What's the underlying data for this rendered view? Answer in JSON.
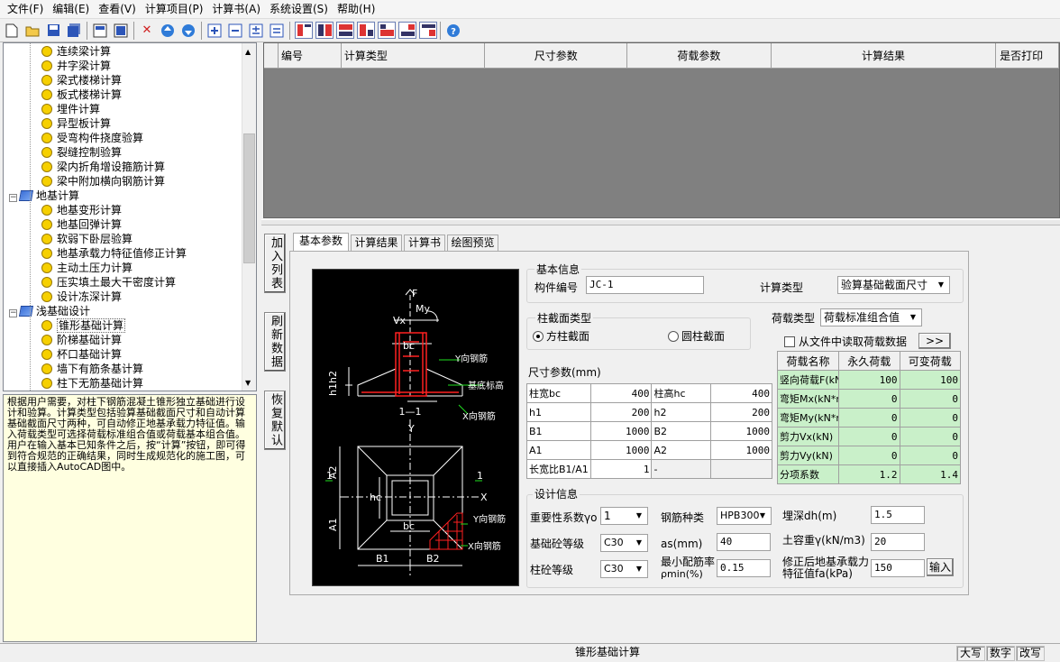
{
  "menu": [
    "文件(F)",
    "编辑(E)",
    "查看(V)",
    "计算项目(P)",
    "计算书(A)",
    "系统设置(S)",
    "帮助(H)"
  ],
  "tree": {
    "items": [
      {
        "label": "连续梁计算",
        "type": "leaf"
      },
      {
        "label": "井字梁计算",
        "type": "leaf"
      },
      {
        "label": "梁式楼梯计算",
        "type": "leaf"
      },
      {
        "label": "板式楼梯计算",
        "type": "leaf"
      },
      {
        "label": "埋件计算",
        "type": "leaf"
      },
      {
        "label": "异型板计算",
        "type": "leaf"
      },
      {
        "label": "受弯构件挠度验算",
        "type": "leaf"
      },
      {
        "label": "裂缝控制验算",
        "type": "leaf"
      },
      {
        "label": "梁内折角增设箍筋计算",
        "type": "leaf"
      },
      {
        "label": "梁中附加横向钢筋计算",
        "type": "leaf"
      },
      {
        "label": "地基计算",
        "type": "group"
      },
      {
        "label": "地基变形计算",
        "type": "leaf"
      },
      {
        "label": "地基回弹计算",
        "type": "leaf"
      },
      {
        "label": "软弱下卧层验算",
        "type": "leaf"
      },
      {
        "label": "地基承载力特征值修正计算",
        "type": "leaf"
      },
      {
        "label": "主动土压力计算",
        "type": "leaf"
      },
      {
        "label": "压实填土最大干密度计算",
        "type": "leaf"
      },
      {
        "label": "设计冻深计算",
        "type": "leaf"
      },
      {
        "label": "浅基础设计",
        "type": "group"
      },
      {
        "label": "锥形基础计算",
        "type": "leaf-selected"
      },
      {
        "label": "阶梯基础计算",
        "type": "leaf"
      },
      {
        "label": "杯口基础计算",
        "type": "leaf"
      },
      {
        "label": "墙下有筋条基计算",
        "type": "leaf"
      },
      {
        "label": "柱下无筋基础计算",
        "type": "leaf"
      }
    ]
  },
  "description": "根据用户需要，对柱下钢筋混凝土锥形独立基础进行设计和验算。计算类型包括验算基础截面尺寸和自动计算基础截面尺寸两种，可自动修正地基承载力特征值。输入荷载类型可选择荷载标准组合值或荷载基本组合值。用户在输入基本已知条件之后，按“计算”按钮，即可得到符合规范的正确结果，同时生成规范化的施工图，可以直接插入AutoCAD图中。",
  "grid": {
    "headers": [
      "编号",
      "计算类型",
      "尺寸参数",
      "荷载参数",
      "计算结果",
      "是否打印"
    ]
  },
  "side_buttons": [
    "加入列表",
    "刷新数据",
    "恢复默认"
  ],
  "tabs": [
    "基本参数",
    "计算结果",
    "计算书",
    "绘图预览"
  ],
  "cad": {
    "labels": {
      "F": "F",
      "My": "My",
      "Vx": "Vx",
      "bc": "bc",
      "h1h2": "h1h2",
      "y_rebar": "Y向钢筋",
      "x_rebar": "X向钢筋",
      "base_elev": "基底标高",
      "section": "1—1",
      "Y": "Y",
      "X": "X",
      "A1": "A1",
      "A2": "A2",
      "hc": "hc",
      "B1": "B1",
      "B2": "B2",
      "one": "1"
    },
    "colors": {
      "line": "#ffffff",
      "rebar": "#ff2020",
      "green": "#20e020"
    }
  },
  "basic": {
    "title": "基本信息",
    "member_id_label": "构件编号",
    "member_id": "JC-1",
    "calc_type_label": "计算类型",
    "calc_type": "验算基础截面尺寸"
  },
  "section": {
    "title": "柱截面类型",
    "square": "方柱截面",
    "round": "圆柱截面"
  },
  "load_type": {
    "label": "荷载类型",
    "value": "荷载标准组合值",
    "read_file": "从文件中读取荷载数据",
    "more": ">>"
  },
  "dims": {
    "title": "尺寸参数(mm)",
    "rows": [
      [
        "柱宽bc",
        "400",
        "柱高hc",
        "400"
      ],
      [
        "h1",
        "200",
        "h2",
        "200"
      ],
      [
        "B1",
        "1000",
        "B2",
        "1000"
      ],
      [
        "A1",
        "1000",
        "A2",
        "1000"
      ],
      [
        "长宽比B1/A1",
        "1",
        "-",
        ""
      ]
    ]
  },
  "loads": {
    "headers": [
      "荷载名称",
      "永久荷载",
      "可变荷载"
    ],
    "rows": [
      [
        "竖向荷载F(kN)",
        "100",
        "100"
      ],
      [
        "弯矩Mx(kN*m)",
        "0",
        "0"
      ],
      [
        "弯矩My(kN*m)",
        "0",
        "0"
      ],
      [
        "剪力Vx(kN)",
        "0",
        "0"
      ],
      [
        "剪力Vy(kN)",
        "0",
        "0"
      ],
      [
        "分项系数",
        "1.2",
        "1.4"
      ]
    ]
  },
  "design": {
    "title": "设计信息",
    "importance_label": "重要性系数γo",
    "importance": "1",
    "rebar_label": "钢筋种类",
    "rebar": "HPB300",
    "depth_label": "埋深dh(m)",
    "depth": "1.5",
    "concrete_label": "基础砼等级",
    "concrete": "C30",
    "as_label": "as(mm)",
    "as": "40",
    "soil_label": "土容重γ(kN/m3)",
    "soil": "20",
    "col_concrete_label": "柱砼等级",
    "col_concrete": "C30",
    "rho_label1": "最小配筋率",
    "rho_label2": "ρmin(%)",
    "rho": "0.15",
    "fa_label1": "修正后地基承载力",
    "fa_label2": "特征值fa(kPa)",
    "fa": "150",
    "input_btn": "输入"
  },
  "status": {
    "main": "锥形基础计算",
    "caps": "大写",
    "num": "数字",
    "ovr": "改写"
  }
}
